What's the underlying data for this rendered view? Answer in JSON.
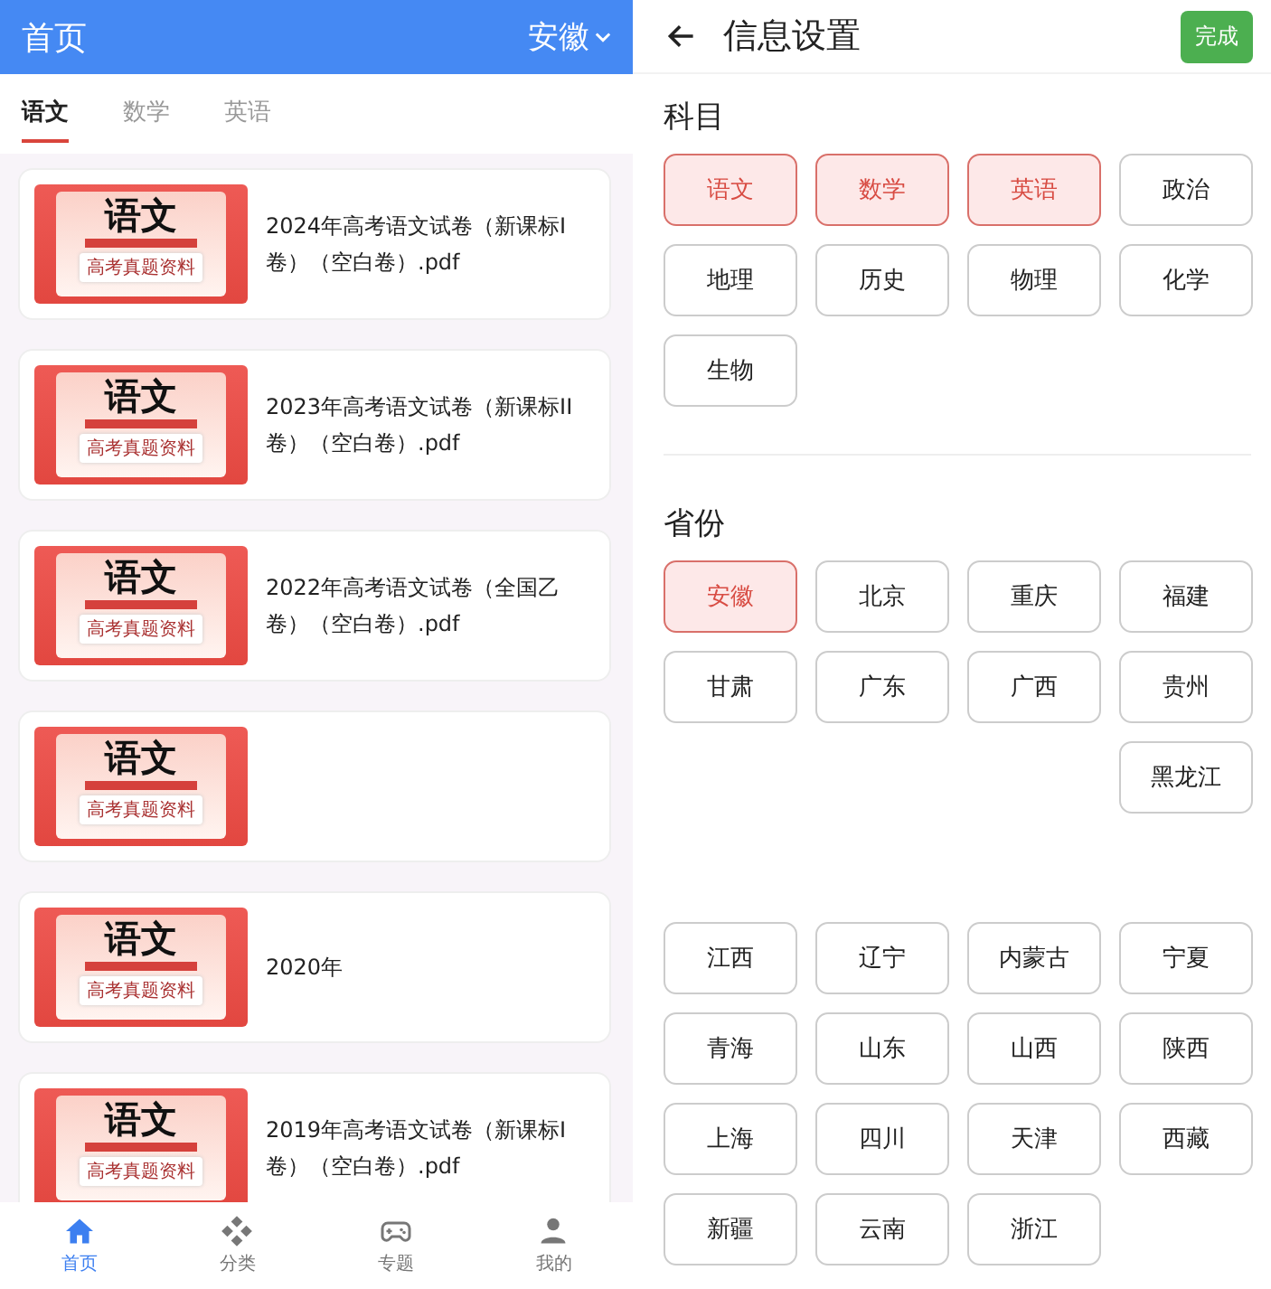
{
  "home": {
    "title": "首页",
    "province": "安徽",
    "tabs": [
      {
        "label": "语文",
        "selected": true
      },
      {
        "label": "数学",
        "selected": false
      },
      {
        "label": "英语",
        "selected": false
      }
    ],
    "papers": [
      {
        "cover_title": "语文",
        "cover_caption": "高考真题资料",
        "title": "2024年高考语文试卷（新课标I卷）（空白卷）.pdf"
      },
      {
        "cover_title": "语文",
        "cover_caption": "高考真题资料",
        "title": "2023年高考语文试卷（新课标II卷）（空白卷）.pdf"
      },
      {
        "cover_title": "语文",
        "cover_caption": "高考真题资料",
        "title": "2022年高考语文试卷（全国乙卷）（空白卷）.pdf"
      },
      {
        "cover_title": "语文",
        "cover_caption": "高考真题资料"
      },
      {
        "cover_title": "语文",
        "cover_caption": "高考真题资料",
        "title": "2020年"
      },
      {
        "cover_title": "语文",
        "cover_caption": "高考真题资料",
        "title": "2019年高考语文试卷（新课标I卷）（空白卷）.pdf"
      }
    ],
    "nav": [
      {
        "label": "首页",
        "selected": true
      },
      {
        "label": "分类",
        "selected": false
      },
      {
        "label": "专题",
        "selected": false
      },
      {
        "label": "我的",
        "selected": false
      }
    ]
  },
  "settings": {
    "title": "信息设置",
    "done_button": "完成",
    "subjects_heading": "科目",
    "subjects": [
      {
        "label": "语文",
        "selected": true
      },
      {
        "label": "数学",
        "selected": true
      },
      {
        "label": "英语",
        "selected": true
      },
      {
        "label": "政治",
        "selected": false
      },
      {
        "label": "地理",
        "selected": false
      },
      {
        "label": "历史",
        "selected": false
      },
      {
        "label": "物理",
        "selected": false
      },
      {
        "label": "化学",
        "selected": false
      },
      {
        "label": "生物",
        "selected": false
      }
    ],
    "provinces_heading": "省份",
    "provinces": [
      {
        "kind": "tile",
        "label": "安徽",
        "selected": true
      },
      {
        "kind": "tile",
        "label": "北京",
        "selected": false
      },
      {
        "kind": "tile",
        "label": "重庆",
        "selected": false
      },
      {
        "kind": "tile",
        "label": "福建",
        "selected": false
      },
      {
        "kind": "tile",
        "label": "甘肃",
        "selected": false
      },
      {
        "kind": "tile",
        "label": "广东",
        "selected": false
      },
      {
        "kind": "tile",
        "label": "广西",
        "selected": false
      },
      {
        "kind": "tile",
        "label": "贵州",
        "selected": false
      },
      {
        "kind": "blank"
      },
      {
        "kind": "blank"
      },
      {
        "kind": "blank"
      },
      {
        "kind": "tile",
        "label": "黑龙江",
        "selected": false
      },
      {
        "kind": "blank"
      },
      {
        "kind": "blank"
      },
      {
        "kind": "blank"
      },
      {
        "kind": "blank"
      },
      {
        "kind": "tile",
        "label": "江西",
        "selected": false
      },
      {
        "kind": "tile",
        "label": "辽宁",
        "selected": false
      },
      {
        "kind": "tile",
        "label": "内蒙古",
        "selected": false
      },
      {
        "kind": "tile",
        "label": "宁夏",
        "selected": false
      },
      {
        "kind": "tile",
        "label": "青海",
        "selected": false
      },
      {
        "kind": "tile",
        "label": "山东",
        "selected": false
      },
      {
        "kind": "tile",
        "label": "山西",
        "selected": false
      },
      {
        "kind": "tile",
        "label": "陕西",
        "selected": false
      },
      {
        "kind": "tile",
        "label": "上海",
        "selected": false
      },
      {
        "kind": "tile",
        "label": "四川",
        "selected": false
      },
      {
        "kind": "tile",
        "label": "天津",
        "selected": false
      },
      {
        "kind": "tile",
        "label": "西藏",
        "selected": false
      },
      {
        "kind": "tile",
        "label": "新疆",
        "selected": false
      },
      {
        "kind": "tile",
        "label": "云南",
        "selected": false
      },
      {
        "kind": "tile",
        "label": "浙江",
        "selected": false
      }
    ]
  }
}
